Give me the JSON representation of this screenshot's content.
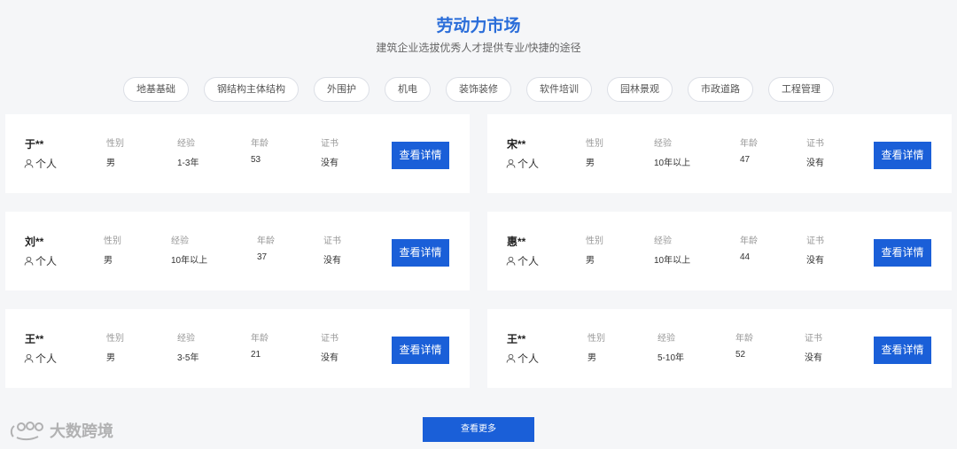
{
  "header": {
    "title": "劳动力市场",
    "subtitle": "建筑企业选拔优秀人才提供专业/快捷的途径"
  },
  "tags": [
    "地基基础",
    "钢结构主体结构",
    "外围护",
    "机电",
    "装饰装修",
    "软件培训",
    "园林景观",
    "市政道路",
    "工程管理"
  ],
  "labels": {
    "gender": "性别",
    "experience": "经验",
    "age": "年龄",
    "cert": "证书",
    "detail_button": "查看详情"
  },
  "workers": [
    {
      "name": "于**",
      "role": "个人",
      "gender": "男",
      "experience": "1-3年",
      "age": "53",
      "cert": "没有"
    },
    {
      "name": "宋**",
      "role": "个人",
      "gender": "男",
      "experience": "10年以上",
      "age": "47",
      "cert": "没有"
    },
    {
      "name": "刘**",
      "role": "个人",
      "gender": "男",
      "experience": "10年以上",
      "age": "37",
      "cert": "没有"
    },
    {
      "name": "惠**",
      "role": "个人",
      "gender": "男",
      "experience": "10年以上",
      "age": "44",
      "cert": "没有"
    },
    {
      "name": "王**",
      "role": "个人",
      "gender": "男",
      "experience": "3-5年",
      "age": "21",
      "cert": "没有"
    },
    {
      "name": "王**",
      "role": "个人",
      "gender": "男",
      "experience": "5-10年",
      "age": "52",
      "cert": "没有"
    }
  ],
  "more_button": "查看更多",
  "watermark": "大数跨境",
  "colors": {
    "accent": "#1a5fd8",
    "title": "#2a6dd9",
    "background": "#f5f6f8"
  }
}
